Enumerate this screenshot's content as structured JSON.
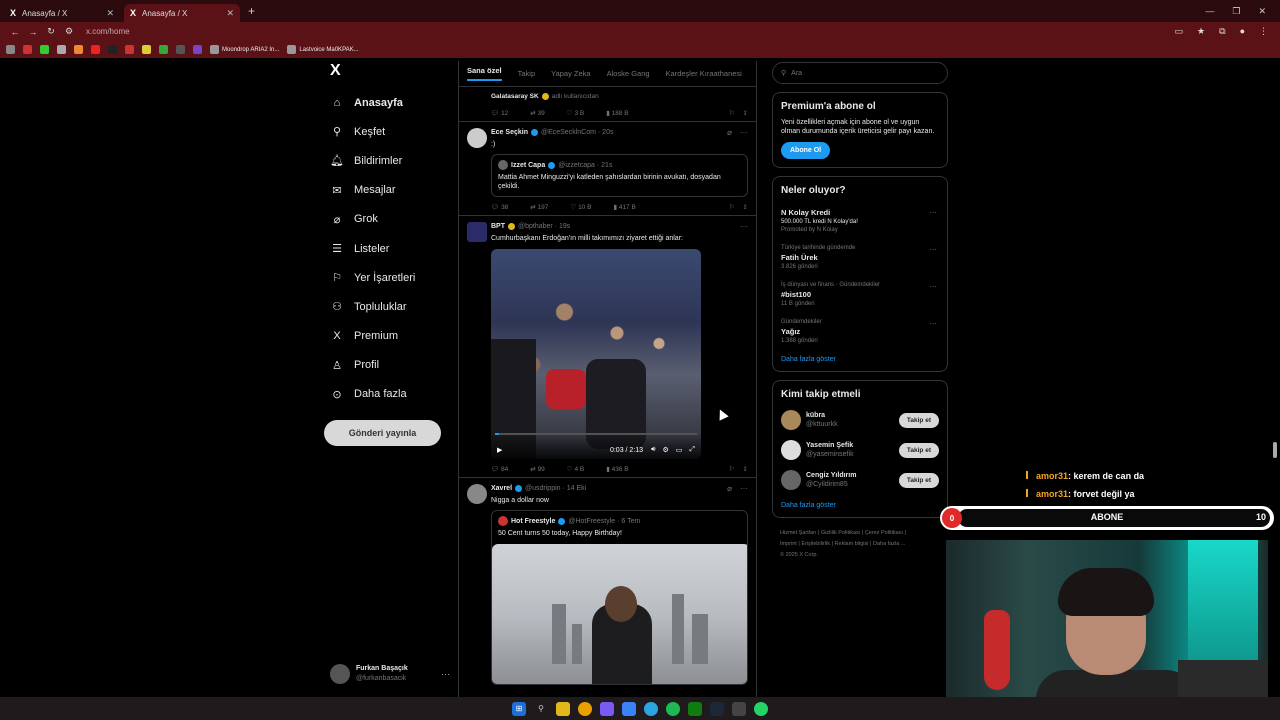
{
  "browser": {
    "tabs": [
      {
        "label": "Anasayfa / X",
        "active": false
      },
      {
        "label": "Anasayfa / X",
        "active": true
      }
    ],
    "url": "x.com/home",
    "bookmarks": [
      "Moondrop ARIA2 In...",
      "Lastvoice Ma0KPAK..."
    ]
  },
  "nav": {
    "items": [
      {
        "label": "Anasayfa",
        "icon": "home-icon",
        "glyph": "⌂",
        "bold": true
      },
      {
        "label": "Keşfet",
        "icon": "search-icon",
        "glyph": "⚲"
      },
      {
        "label": "Bildirimler",
        "icon": "bell-icon",
        "glyph": "🔔︎"
      },
      {
        "label": "Mesajlar",
        "icon": "mail-icon",
        "glyph": "✉"
      },
      {
        "label": "Grok",
        "icon": "grok-icon",
        "glyph": "⌀"
      },
      {
        "label": "Listeler",
        "icon": "list-icon",
        "glyph": "☰"
      },
      {
        "label": "Yer İşaretleri",
        "icon": "bookmark-icon",
        "glyph": "⚐"
      },
      {
        "label": "Topluluklar",
        "icon": "community-icon",
        "glyph": "⚇"
      },
      {
        "label": "Premium",
        "icon": "x-premium-icon",
        "glyph": "X"
      },
      {
        "label": "Profil",
        "icon": "profile-icon",
        "glyph": "♙"
      },
      {
        "label": "Daha fazla",
        "icon": "more-circle-icon",
        "glyph": "⊙"
      }
    ],
    "post_button": "Gönderi yayınla",
    "profile": {
      "name": "Furkan Başaçık",
      "handle": "@furkanbasacik"
    }
  },
  "timeline": {
    "tabs": [
      "Sana özel",
      "Takip",
      "Yapay Zeka",
      "Aloske Gang",
      "Kardeşler Kıraathanesi"
    ],
    "top_meta": {
      "source": "Galatasaray SK",
      "suffix": "adlı kullanıcıdan"
    },
    "top_actions": {
      "replies": "12",
      "reposts": "39",
      "likes": "3 B",
      "views": "188 B"
    },
    "posts": [
      {
        "name": "Ece Seçkin",
        "handle": "@EceSecklnCom",
        "time": "20s",
        "text": ":)",
        "quote": {
          "name": "Izzet Capa",
          "handle": "@izzetcapa",
          "time": "21s",
          "text": "Mattia Ahmet Minguzzi'yi katleden şahıslardan birinin avukatı, dosyadan çekildi."
        },
        "actions": {
          "replies": "38",
          "reposts": "197",
          "likes": "10 B",
          "views": "417 B"
        }
      },
      {
        "name": "BPT",
        "handle": "@bpthaber",
        "time": "19s",
        "text": "Cumhurbaşkanı Erdoğan'ın milli takımımızı ziyaret ettiği anlar:",
        "video": {
          "time": "0:03 / 2:13",
          "progress": 0.02
        },
        "actions": {
          "replies": "84",
          "reposts": "99",
          "likes": "4 B",
          "views": "436 B"
        }
      },
      {
        "name": "Xavrel",
        "handle": "@usdrippin",
        "time": "14 Eki",
        "text": "Nigga a dollar now",
        "quote": {
          "name": "Hot Freestyle",
          "handle": "@HotFreestyle",
          "time": "6 Tem",
          "text": "50 Cent turns 50 today, Happy Birthday!"
        }
      }
    ]
  },
  "sidebar": {
    "search_placeholder": "Ara",
    "premium": {
      "title": "Premium'a abone ol",
      "text": "Yeni özellikleri açmak için abone ol ve uygun olman durumunda içerik üreticisi gelir payı kazan.",
      "button": "Abone Ol"
    },
    "trends_title": "Neler oluyor?",
    "trends": [
      {
        "context": "",
        "title": "N Kolay Kredi",
        "count": "500.000 TL kredi N Kolay'da!",
        "promo": "Promoted by N Kolay"
      },
      {
        "context": "Türkiye tarihinde gündemde",
        "title": "Fatih Ürek",
        "count": "3.826 gönderi"
      },
      {
        "context": "İş dünyası ve finans · Gündemdekiler",
        "title": "#bist100",
        "count": "11 B gönderi"
      },
      {
        "context": "Gündemdekiler",
        "title": "Yağız",
        "count": "1.388 gönderi"
      }
    ],
    "show_more": "Daha fazla göster",
    "who_title": "Kimi takip etmeli",
    "who": [
      {
        "name": "kübra",
        "handle": "@kttuurkk",
        "button": "Takip et"
      },
      {
        "name": "Yasemin Şefik",
        "handle": "@yaseminsefik",
        "button": "Takip et"
      },
      {
        "name": "Cengiz Yıldırım",
        "handle": "@Cyildirim85",
        "button": "Takip et"
      }
    ],
    "who_show_more": "Daha fazla göster",
    "footer": [
      "Hizmet Şartları",
      "Gizlilik Politikası",
      "Çerez Politikası",
      "Imprint",
      "Erişilebilirlik",
      "Reklam bilgisi",
      "Daha fazla ...",
      "© 2025 X Corp."
    ]
  },
  "stream": {
    "chat": [
      {
        "user": "amor31",
        "message": ": kerem de can da"
      },
      {
        "user": "amor31",
        "message": ": forvet değil ya"
      }
    ],
    "sub_goal": {
      "current": "0",
      "label": "ABONE",
      "target": "10"
    }
  },
  "colors": {
    "accent": "#1d9bf0",
    "browser": "#5a1217",
    "chat_user": "#f5a623",
    "abone_red": "#e02a2a"
  }
}
